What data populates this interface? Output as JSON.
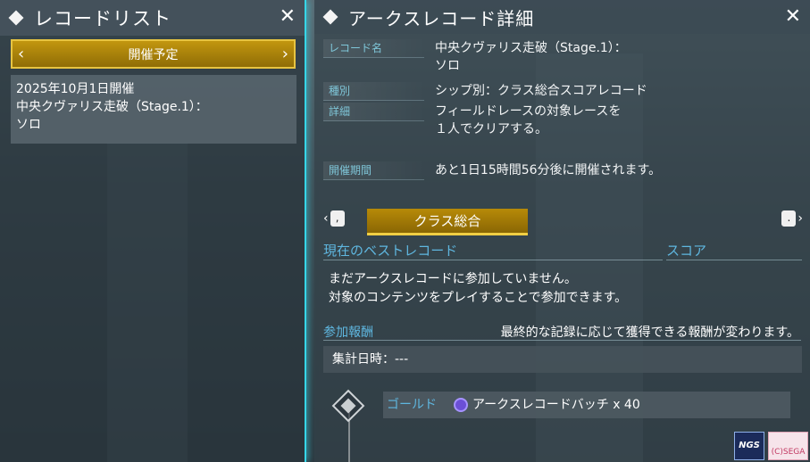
{
  "left_panel": {
    "title": "レコードリスト",
    "close": "✕",
    "period_label": "開催予定",
    "arrow_left": "‹",
    "arrow_right": "›",
    "record": {
      "date": "2025年10月1日開催",
      "name": "中央クヴァリス走破（Stage.1）：",
      "mode": "ソロ"
    }
  },
  "right_panel": {
    "title": "アークスレコード詳細",
    "close": "✕",
    "fields": {
      "record_name_key": "レコード名",
      "record_name_val1": "中央クヴァリス走破（Stage.1）：",
      "record_name_val2": "ソロ",
      "type_key": "種別",
      "type_val": "シップ別：クラス総合スコアレコード",
      "detail_key": "詳細",
      "detail_val1": "フィールドレースの対象レースを",
      "detail_val2": "１人でクリアする。",
      "period_key": "開催期間",
      "period_val": "あと1日15時間56分後に開催されます。"
    },
    "tab": {
      "prev_arrow": "‹",
      "prev_key": ",",
      "label": "クラス総合",
      "next_key": ".",
      "next_arrow": "›"
    },
    "best_record_label": "現在のベストレコード",
    "score_label": "スコア",
    "best_msg1": "まだアークスレコードに参加していません。",
    "best_msg2": "対象のコンテンツをプレイすることで参加できます。",
    "reward_label": "参加報酬",
    "reward_note": "最終的な記録に応じて獲得できる報酬が変わります。",
    "tally": "集計日時：---",
    "reward_row": {
      "tier": "ゴールド",
      "item": "アークスレコードバッチ x 40"
    }
  },
  "logos": {
    "ngs": "NGS",
    "copyright": "(C)SEGA"
  },
  "colors": {
    "accent_cyan": "#36d6e8",
    "gold": "#b78a08",
    "label_blue": "#5fb7e0"
  }
}
